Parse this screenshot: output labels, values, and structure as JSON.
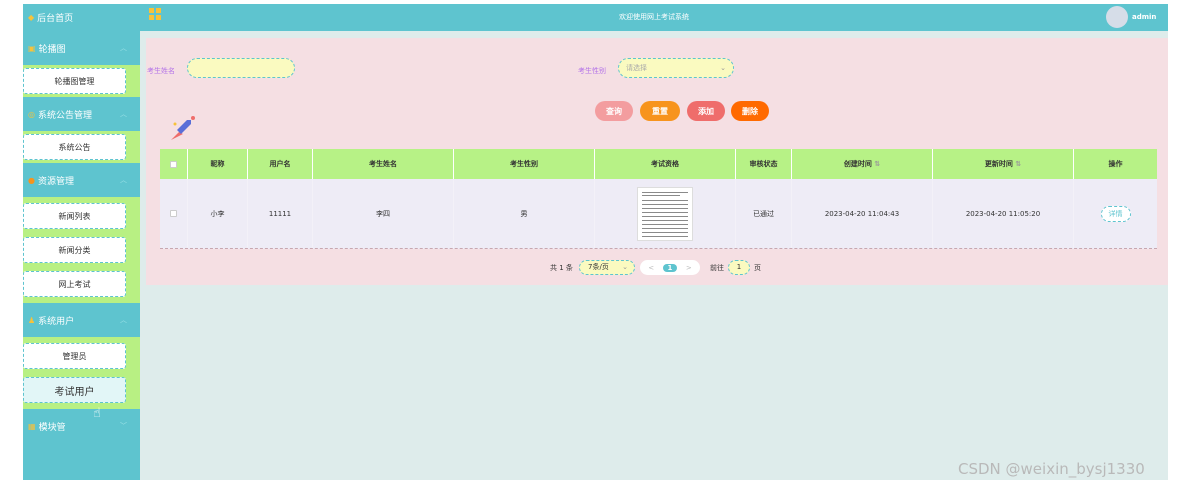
{
  "sidebar": {
    "home": {
      "label": "后台首页",
      "icon": "home-icon"
    },
    "groups": [
      {
        "label": "轮播图",
        "icon": "image-icon",
        "items": [
          "轮播图管理"
        ]
      },
      {
        "label": "系统公告管理",
        "icon": "notice-icon",
        "items": [
          "系统公告"
        ]
      },
      {
        "label": "资源管理",
        "icon": "folder-icon",
        "items": [
          "新闻列表",
          "新闻分类",
          "网上考试"
        ]
      },
      {
        "label": "系统用户",
        "icon": "user-icon",
        "items": [
          "管理员",
          "考试用户"
        ]
      },
      {
        "label": "模块管",
        "icon": "module-icon",
        "items": []
      }
    ],
    "stray_text": "哥"
  },
  "header": {
    "title": "欢迎使用网上考试系统",
    "user": "admin"
  },
  "search": {
    "name_label": "考生姓名",
    "name_value": "",
    "gender_label": "考生性别",
    "gender_placeholder": "请选择"
  },
  "buttons": {
    "query": "查询",
    "reset": "重置",
    "add": "添加",
    "delete": "删除"
  },
  "colors": {
    "query": "#f39d9f",
    "reset": "#f7941d",
    "add": "#ef6d6b",
    "delete": "#ff6a00",
    "accent": "#5ec4cf"
  },
  "table": {
    "headers": [
      "昵称",
      "用户名",
      "考生姓名",
      "考生性别",
      "考试资格",
      "审核状态",
      "创建时间",
      "更新时间",
      "操作"
    ],
    "sort_icon": "⇅",
    "rows": [
      {
        "nickname": "小李",
        "username": "11111",
        "name": "李四",
        "gender": "男",
        "status": "已通过",
        "created": "2023-04-20 11:04:43",
        "updated": "2023-04-20 11:05:20",
        "action": "详情"
      }
    ]
  },
  "pagination": {
    "total": "共 1 条",
    "page_size": "7条/页",
    "prev": "<",
    "current": "1",
    "next": ">",
    "goto_label": "前往",
    "goto_value": "1",
    "page_unit": "页"
  },
  "watermark": "CSDN @weixin_bysj1330"
}
